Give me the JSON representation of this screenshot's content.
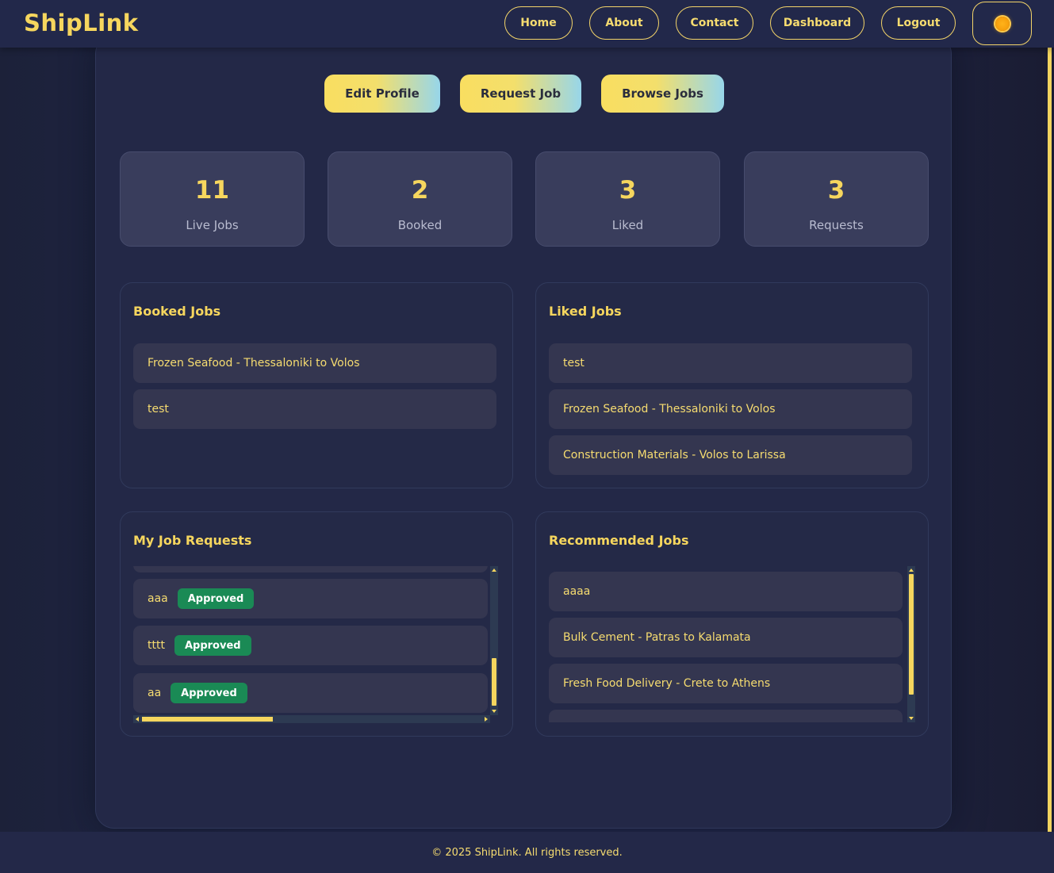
{
  "navbar": {
    "brand": "ShipLink",
    "links": [
      "Home",
      "About",
      "Contact",
      "Dashboard",
      "Logout"
    ],
    "theme_icon": "sun-icon"
  },
  "actions": {
    "edit_profile": "Edit Profile",
    "request_job": "Request Job",
    "browse_jobs": "Browse Jobs"
  },
  "stats": [
    {
      "value": "11",
      "label": "Live Jobs"
    },
    {
      "value": "2",
      "label": "Booked"
    },
    {
      "value": "3",
      "label": "Liked"
    },
    {
      "value": "3",
      "label": "Requests"
    }
  ],
  "booked_jobs": {
    "title": "Booked Jobs",
    "items": [
      "Frozen Seafood - Thessaloniki to Volos",
      "test"
    ]
  },
  "liked_jobs": {
    "title": "Liked Jobs",
    "items": [
      "test",
      "Frozen Seafood - Thessaloniki to Volos",
      "Construction Materials - Volos to Larissa"
    ]
  },
  "job_requests": {
    "title": "My Job Requests",
    "items": [
      {
        "name": "aaa",
        "status": "Approved"
      },
      {
        "name": "tttt",
        "status": "Approved"
      },
      {
        "name": "aa",
        "status": "Approved"
      }
    ]
  },
  "recommended_jobs": {
    "title": "Recommended Jobs",
    "items": [
      "aaaa",
      "Bulk Cement - Patras to Kalamata",
      "Fresh Food Delivery - Crete to Athens"
    ]
  },
  "footer": {
    "text": "© 2025 ShipLink. All rights reserved."
  },
  "colors": {
    "accent": "#f6d65e",
    "approved": "#1a8a55",
    "background": "#232847"
  }
}
